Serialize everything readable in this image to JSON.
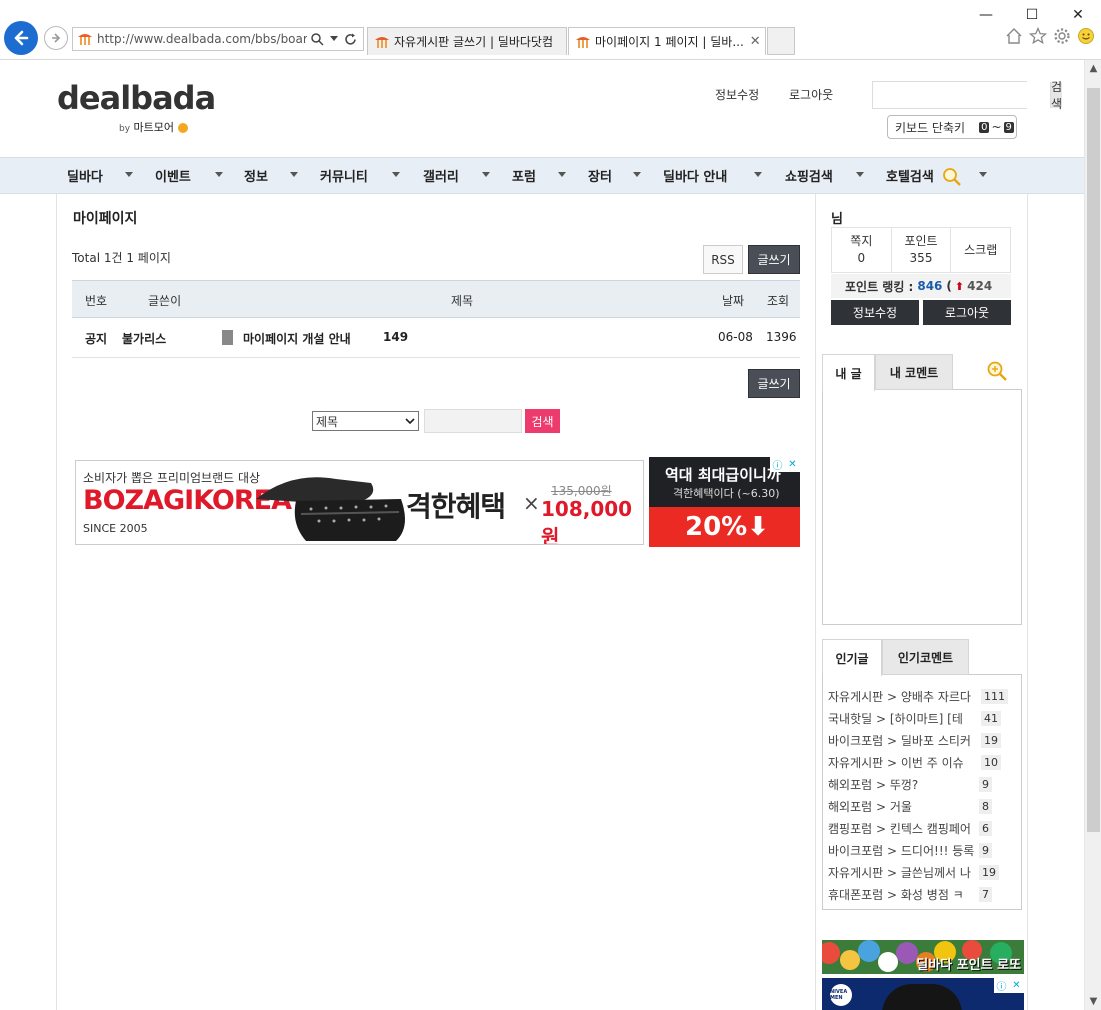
{
  "browser": {
    "url": "http://www.dealbada.com/bbs/board.p",
    "tabs": [
      {
        "title": "자유게시판 글쓰기 | 딜바다닷컴"
      },
      {
        "title": "마이페이지 1 페이지 | 딜바...",
        "close": "✕"
      }
    ],
    "window_controls": {
      "minimize": "—",
      "maximize": "☐",
      "close": "✕"
    }
  },
  "header": {
    "logo": "dealbada",
    "logo_by": "by",
    "logo_sub": "마트모어",
    "links": {
      "edit_info": "정보수정",
      "logout": "로그아웃"
    },
    "search_button": "검색",
    "keyboard_shortcut": {
      "label": "키보드 단축키",
      "from": "0",
      "sep": "~",
      "to": "9"
    }
  },
  "nav": [
    "딜바다",
    "이벤트",
    "정보",
    "커뮤니티",
    "갤러리",
    "포럼",
    "장터",
    "딜바다 안내",
    "쇼핑검색",
    "호텔검색"
  ],
  "board": {
    "title": "마이페이지",
    "total": "Total 1건 1 페이지",
    "rss": "RSS",
    "write": "글쓰기",
    "columns": {
      "no": "번호",
      "author": "글쓴이",
      "subject": "제목",
      "date": "날짜",
      "views": "조회"
    },
    "rows": [
      {
        "no": "공지",
        "author": "불가리스",
        "subject": "마이페이지 개설 안내",
        "comments": "149",
        "date": "06-08",
        "views": "1396"
      }
    ],
    "search_field": "제목",
    "search_button": "검색"
  },
  "ad": {
    "sub": "소비자가 뽑은 프리미엄브랜드 대상",
    "brand": "BOZAGIKOREA",
    "since": "SINCE 2005",
    "benefit": "격한혜택",
    "times": "×",
    "old_price": "135,000원",
    "new_price": "108,000원",
    "right_line1": "역대 최대급이니까",
    "right_line2": "격한혜택이다 (~6.30)",
    "right_pct": "20%⬇",
    "info_icon": "ⓘ",
    "close_icon": "✕"
  },
  "sidebar": {
    "user_name": "님",
    "stats": [
      {
        "label": "쪽지",
        "value": "0"
      },
      {
        "label": "포인트",
        "value": "355"
      },
      {
        "label": "스크랩",
        "value": ""
      }
    ],
    "ranking_label": "포인트 랭킹 :",
    "ranking_value": "846",
    "ranking_paren": "(",
    "ranking_arrow": "⬆",
    "ranking_delta": "424",
    "edit_info": "정보수정",
    "logout": "로그아웃",
    "my_tabs": [
      "내 글",
      "내 코멘트"
    ],
    "pop_tabs": [
      "인기글",
      "인기코멘트"
    ],
    "popular": [
      {
        "text": "자유게시판 > 양배추 자르다",
        "count": "111"
      },
      {
        "text": "국내핫딜 > [하이마트] [테",
        "count": "41"
      },
      {
        "text": "바이크포럼 > 딜바포 스티커",
        "count": "19"
      },
      {
        "text": "자유게시판 > 이번 주 이슈",
        "count": "10"
      },
      {
        "text": "해외포럼 > 뚜껑?",
        "count": "9"
      },
      {
        "text": "해외포럼 > 거울",
        "count": "8"
      },
      {
        "text": "캠핑포럼 > 킨텍스 캠핑페어",
        "count": "6"
      },
      {
        "text": "바이크포럼 > 드디어!!! 등록",
        "count": "9"
      },
      {
        "text": "자유게시판 > 글쓴님께서 나",
        "count": "19"
      },
      {
        "text": "휴대폰포럼 > 화성 병점 ㅋ",
        "count": "7"
      }
    ],
    "lotto": "딜바다 포인트 로또",
    "nivea": "NIVEA MEN"
  },
  "colors": {
    "accent_pink": "#ec3b6c",
    "nav_bg": "#e8eef5",
    "dark_button": "#4a4f57",
    "ad_red": "#e0192a"
  }
}
